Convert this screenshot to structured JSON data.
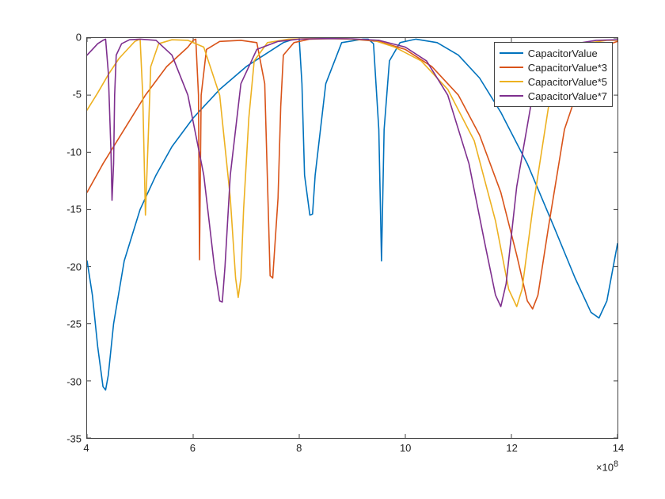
{
  "chart_data": {
    "type": "line",
    "xlim": [
      4,
      14
    ],
    "ylim": [
      -35,
      0
    ],
    "x_exponent": "×10",
    "x_exponent_sup": "8",
    "x_ticks": [
      4,
      6,
      8,
      10,
      12,
      14
    ],
    "y_ticks": [
      0,
      -5,
      -10,
      -15,
      -20,
      -25,
      -30,
      -35
    ],
    "legend_position": "upper-right-inset",
    "series": [
      {
        "name": "CapacitorValue",
        "color": "#0072BD",
        "x": [
          4.0,
          4.1,
          4.2,
          4.3,
          4.35,
          4.4,
          4.5,
          4.7,
          5.0,
          5.3,
          5.6,
          6.0,
          6.5,
          7.0,
          7.5,
          7.7,
          7.9,
          8.0,
          8.05,
          8.1,
          8.2,
          8.25,
          8.3,
          8.5,
          8.8,
          9.2,
          9.3,
          9.4,
          9.5,
          9.55,
          9.6,
          9.7,
          9.9,
          10.2,
          10.6,
          11.0,
          11.4,
          11.8,
          12.3,
          12.8,
          13.2,
          13.5,
          13.65,
          13.8,
          14.0
        ],
        "y": [
          -19.5,
          -22.5,
          -27.0,
          -30.5,
          -30.8,
          -29.5,
          -25.0,
          -19.5,
          -15.0,
          -12.0,
          -9.5,
          -7.0,
          -4.5,
          -2.5,
          -1.0,
          -0.4,
          -0.1,
          -0.1,
          -4.0,
          -12.0,
          -15.5,
          -15.4,
          -12.0,
          -4.0,
          -0.4,
          -0.1,
          -0.1,
          -0.5,
          -8.0,
          -19.5,
          -8.0,
          -2.0,
          -0.4,
          -0.1,
          -0.4,
          -1.5,
          -3.5,
          -6.5,
          -11.0,
          -16.5,
          -21.0,
          -24.0,
          -24.5,
          -23.0,
          -18.0
        ]
      },
      {
        "name": "CapacitorValue*3",
        "color": "#D95319",
        "x": [
          4.0,
          4.3,
          4.7,
          5.1,
          5.5,
          5.9,
          6.0,
          6.05,
          6.1,
          6.12,
          6.15,
          6.25,
          6.5,
          6.9,
          7.2,
          7.35,
          7.45,
          7.5,
          7.6,
          7.65,
          7.7,
          7.9,
          8.2,
          8.6,
          9.0,
          9.5,
          10.0,
          10.5,
          11.0,
          11.4,
          11.8,
          12.1,
          12.3,
          12.4,
          12.5,
          12.7,
          13.0,
          13.4,
          13.8,
          14.0
        ],
        "y": [
          -13.5,
          -11.0,
          -8.0,
          -5.0,
          -2.5,
          -0.8,
          -0.2,
          -0.1,
          -5.0,
          -19.4,
          -5.0,
          -1.0,
          -0.3,
          -0.2,
          -0.4,
          -4.0,
          -20.8,
          -21.0,
          -14.0,
          -6.0,
          -1.5,
          -0.4,
          -0.1,
          -0.05,
          -0.1,
          -0.3,
          -1.0,
          -2.5,
          -5.0,
          -8.5,
          -13.5,
          -19.0,
          -23.0,
          -23.7,
          -22.5,
          -16.5,
          -8.0,
          -2.5,
          -0.6,
          -0.3
        ]
      },
      {
        "name": "CapacitorValue*5",
        "color": "#EDB120",
        "x": [
          4.0,
          4.2,
          4.4,
          4.6,
          4.8,
          4.9,
          5.0,
          5.05,
          5.1,
          5.15,
          5.2,
          5.35,
          5.6,
          5.9,
          6.2,
          6.5,
          6.7,
          6.8,
          6.85,
          6.9,
          6.95,
          7.05,
          7.15,
          7.4,
          7.8,
          8.3,
          8.9,
          9.4,
          9.8,
          10.3,
          10.8,
          11.3,
          11.7,
          11.95,
          12.1,
          12.2,
          12.4,
          12.7,
          13.1,
          13.5,
          13.8,
          14.0
        ],
        "y": [
          -6.3,
          -4.8,
          -3.2,
          -1.8,
          -0.8,
          -0.3,
          -0.1,
          -5.0,
          -15.5,
          -9.0,
          -2.5,
          -0.5,
          -0.15,
          -0.2,
          -0.8,
          -5.0,
          -14.0,
          -21.0,
          -22.7,
          -21.0,
          -15.0,
          -7.0,
          -2.0,
          -0.4,
          -0.1,
          -0.05,
          -0.07,
          -0.2,
          -0.8,
          -2.0,
          -4.5,
          -9.0,
          -16.0,
          -22.0,
          -23.5,
          -22.0,
          -15.0,
          -6.0,
          -1.5,
          -0.4,
          -0.2,
          -0.2
        ]
      },
      {
        "name": "CapacitorValue*7",
        "color": "#7E2F8E",
        "x": [
          4.0,
          4.1,
          4.2,
          4.3,
          4.35,
          4.4,
          4.45,
          4.47,
          4.5,
          4.52,
          4.55,
          4.65,
          4.8,
          5.0,
          5.3,
          5.6,
          5.9,
          6.2,
          6.4,
          6.5,
          6.55,
          6.6,
          6.7,
          6.9,
          7.2,
          7.6,
          8.0,
          8.5,
          9.0,
          9.5,
          10.0,
          10.4,
          10.8,
          11.2,
          11.5,
          11.7,
          11.8,
          11.9,
          12.1,
          12.4,
          12.8,
          13.2,
          13.6,
          14.0
        ],
        "y": [
          -1.5,
          -1.0,
          -0.5,
          -0.2,
          -0.1,
          -3.0,
          -10.0,
          -14.2,
          -11.0,
          -5.0,
          -1.5,
          -0.5,
          -0.15,
          -0.1,
          -0.2,
          -1.5,
          -5.0,
          -12.0,
          -20.0,
          -23.0,
          -23.1,
          -20.0,
          -12.0,
          -4.0,
          -1.0,
          -0.3,
          -0.1,
          -0.05,
          -0.07,
          -0.2,
          -0.8,
          -2.0,
          -5.0,
          -11.0,
          -18.0,
          -22.5,
          -23.5,
          -21.5,
          -13.0,
          -5.0,
          -1.5,
          -0.5,
          -0.2,
          -0.15
        ]
      }
    ]
  },
  "y_tick_labels": [
    "0",
    "-5",
    "-10",
    "-15",
    "-20",
    "-25",
    "-30",
    "-35"
  ],
  "x_tick_labels": [
    "4",
    "6",
    "8",
    "10",
    "12",
    "14"
  ],
  "legend": [
    "CapacitorValue",
    "CapacitorValue*3",
    "CapacitorValue*5",
    "CapacitorValue*7"
  ]
}
